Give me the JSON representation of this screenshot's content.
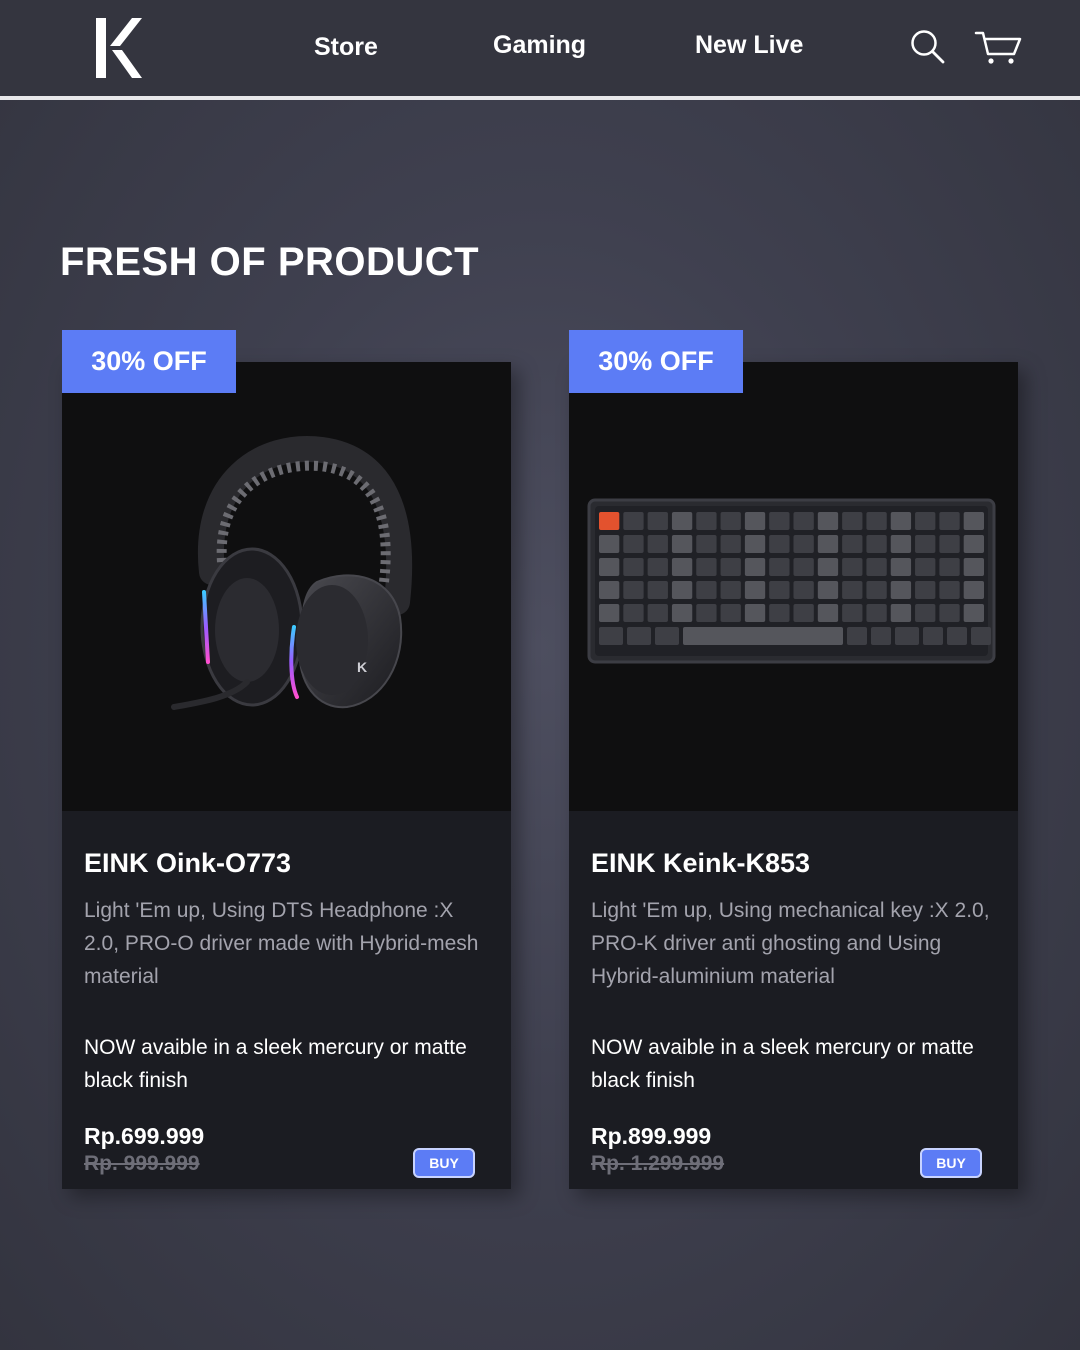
{
  "header": {
    "logo_text": "K",
    "nav": [
      {
        "label": "Store"
      },
      {
        "label": "Gaming"
      },
      {
        "label": "New Live"
      }
    ],
    "icons": [
      "search-icon",
      "cart-icon"
    ]
  },
  "section": {
    "title": "FRESH OF PRODUCT"
  },
  "products": [
    {
      "badge": "30% OFF",
      "image_icon": "headphone-image",
      "name": "EINK Oink-O773",
      "description": "Light 'Em up, Using DTS Headphone :X 2.0, PRO-O driver made with Hybrid-mesh material",
      "finish": "NOW avaible in a sleek mercury or matte black finish",
      "price": "Rp.699.999",
      "old_price": "Rp. 999.999",
      "buy_label": "BUY"
    },
    {
      "badge": "30% OFF",
      "image_icon": "keyboard-image",
      "name": "EINK Keink-K853",
      "description": "Light 'Em up, Using mechanical key :X 2.0, PRO-K driver anti ghosting and Using Hybrid-aluminium material",
      "finish": "NOW avaible in a sleek mercury or matte black finish",
      "price": "Rp.899.999",
      "old_price": "Rp. 1.299.999",
      "buy_label": "BUY"
    }
  ],
  "colors": {
    "background": "#3f404f",
    "header": "#34353f",
    "card": "#1b1c22",
    "card_image": "#0f0f10",
    "accent": "#5c7cf5",
    "muted_text": "#a3a3ad",
    "key_accent": "#e3522e"
  }
}
